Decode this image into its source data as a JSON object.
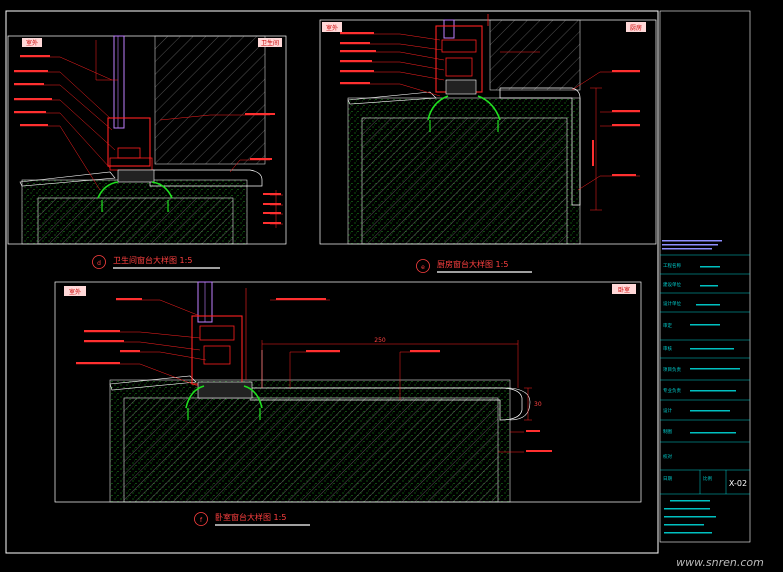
{
  "colors": {
    "background": "#000000",
    "frame": "#ffffff",
    "window_frame": "#ff2020",
    "glass": "#c080ff",
    "gasket": "#20d020",
    "concrete_dots": "#20c020",
    "hatch": "#909090",
    "leader": "#ff2020",
    "dimension": "#ff2020",
    "title_block_cyan": "#00d0d0",
    "tag_fill": "#ffd8d8",
    "tag_text": "#cc0000",
    "title_text": "#ff4040"
  },
  "details": {
    "d": {
      "marker": "d",
      "title": "卫生间窗台大样图 1:5",
      "tag_left": "室外",
      "tag_right": "卫生间"
    },
    "e": {
      "marker": "e",
      "title": "厨房窗台大样图 1:5",
      "tag_left": "室外",
      "tag_right": "厨房"
    },
    "f": {
      "marker": "f",
      "title": "卧室窗台大样图 1:5",
      "tag_left": "室外",
      "tag_right": "卧室",
      "dimension": "250",
      "dim_side": "30"
    }
  },
  "title_block": {
    "sheet_number": "X-02",
    "rows": [
      "工程名称",
      "建设单位",
      "设计单位",
      "审定",
      "审核",
      "项目负责",
      "专业负责",
      "设计",
      "制图",
      "校对",
      "日期",
      "比例"
    ]
  },
  "watermark": "www.snren.com"
}
